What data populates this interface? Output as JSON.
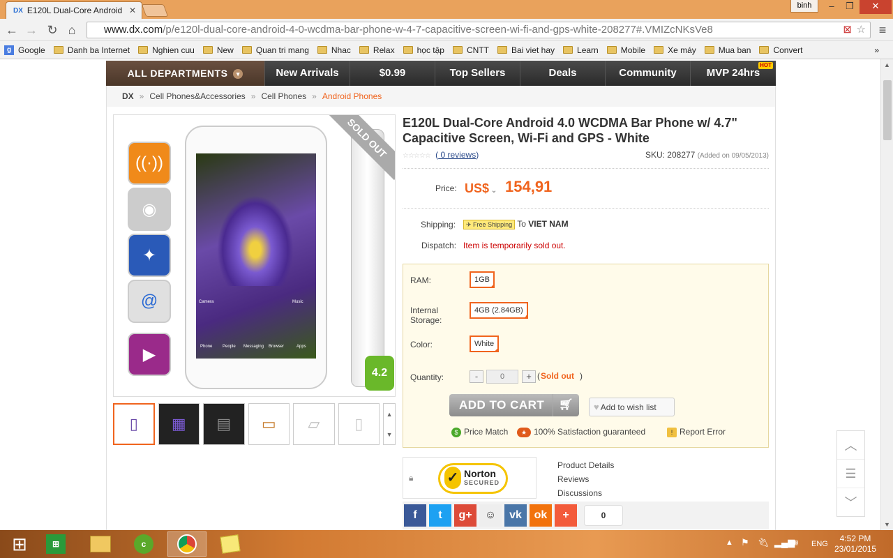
{
  "browser": {
    "tab_title": "E120L Dual-Core Android",
    "tab_favicon": "DX",
    "user_name": "binh",
    "url_domain": "www.dx.com",
    "url_path": "/p/e120l-dual-core-android-4-0-wcdma-bar-phone-w-4-7-capacitive-screen-wi-fi-and-gps-white-208277#.VMIZcNKsVe8",
    "bookmarks": [
      "Google",
      "Danh ba Internet",
      "Nghien cuu",
      "New",
      "Quan tri mang",
      "Nhac",
      "Relax",
      "học tập",
      "CNTT",
      "Bai viet hay",
      "Learn",
      "Mobile",
      "Xe máy",
      "Mua ban",
      "Convert"
    ],
    "more_bookmarks": "»"
  },
  "nav": {
    "all_departments": "ALL DEPARTMENTS",
    "items": [
      "New Arrivals",
      "$0.99",
      "Top Sellers",
      "Deals",
      "Community",
      "MVP 24hrs"
    ],
    "hot_badge": "HOT"
  },
  "breadcrumb": {
    "items": [
      "DX",
      "Cell Phones&Accessories",
      "Cell Phones"
    ],
    "current": "Android Phones",
    "separator": "»"
  },
  "product": {
    "sold_out_ribbon": "SOLD OUT",
    "title": "E120L Dual-Core Android 4.0 WCDMA Bar Phone w/ 4.7\" Capacitive Screen, Wi-Fi and GPS - White",
    "stars": "☆☆☆☆☆",
    "reviews_open": "(",
    "reviews_link": " 0 reviews",
    "reviews_close": ")",
    "sku_label": "SKU: 208277",
    "added": "(Added on 09/05/2013)",
    "price_label": "Price:",
    "currency": "US$",
    "price": "154,91",
    "shipping_label": "Shipping:",
    "free_shipping": "Free Shipping",
    "ship_to": "To",
    "country": "VIET NAM",
    "dispatch_label": "Dispatch:",
    "dispatch_status": "Item is temporarily sold out.",
    "android_badge": "4.2"
  },
  "options": {
    "ram_label": "RAM:",
    "ram_value": "1GB",
    "storage_label_1": "Internal",
    "storage_label_2": "Storage:",
    "storage_value": "4GB (2.84GB)",
    "color_label": "Color:",
    "color_value": "White",
    "quantity_label": "Quantity:",
    "qty_minus": "-",
    "qty_value": "0",
    "qty_plus": "+",
    "qty_status_open": "(",
    "qty_status": "Sold out",
    "qty_status_close": ")",
    "add_to_cart": "ADD TO CART",
    "wish_list": "Add to wish list",
    "price_match": "Price Match",
    "satisfaction": "100% Satisfaction guaranteed",
    "report_error": "Report Error"
  },
  "norton": {
    "brand": "Norton",
    "secured": "SECURED"
  },
  "product_links": [
    "Product Details",
    "Reviews",
    "Discussions"
  ],
  "social": {
    "count": "0"
  },
  "phone_apps": [
    "Camera",
    "Music",
    "Phone",
    "People",
    "Messaging",
    "Browser",
    "Apps"
  ],
  "taskbar": {
    "lang": "ENG",
    "time": "4:52 PM",
    "date": "23/01/2015"
  },
  "colors": {
    "accent": "#f0641e",
    "nav_bg": "#333333",
    "taskbar": "#d27a32"
  }
}
